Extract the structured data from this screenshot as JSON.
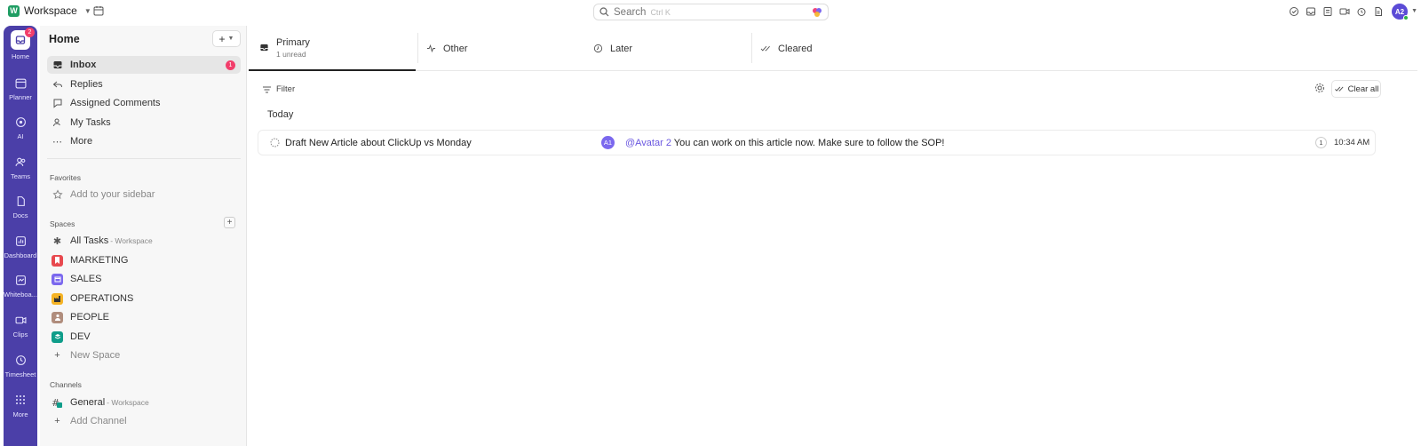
{
  "topbar": {
    "workspace_logo": "W",
    "workspace_name": "Workspace",
    "search_placeholder": "Search",
    "search_shortcut": "Ctrl K",
    "avatar": "A2"
  },
  "rail": {
    "home_badge": "2",
    "items": [
      {
        "label": "Home",
        "icon": "home-icon"
      },
      {
        "label": "Planner",
        "icon": "calendar-icon"
      },
      {
        "label": "AI",
        "icon": "ai-icon"
      },
      {
        "label": "Teams",
        "icon": "teams-icon"
      },
      {
        "label": "Docs",
        "icon": "docs-icon"
      },
      {
        "label": "Dashboard",
        "icon": "dashboard-icon"
      },
      {
        "label": "Whiteboa...",
        "icon": "whiteboard-icon"
      },
      {
        "label": "Clips",
        "icon": "clips-icon"
      },
      {
        "label": "Timesheet",
        "icon": "clock-icon"
      },
      {
        "label": "More",
        "icon": "grid-icon"
      }
    ]
  },
  "sidebar": {
    "title": "Home",
    "nav": [
      {
        "label": "Inbox",
        "badge": "1"
      },
      {
        "label": "Replies"
      },
      {
        "label": "Assigned Comments"
      },
      {
        "label": "My Tasks"
      },
      {
        "label": "More"
      }
    ],
    "favorites_label": "Favorites",
    "favorites_add": "Add to your sidebar",
    "spaces_label": "Spaces",
    "spaces": [
      {
        "label": "All Tasks",
        "sub": "- Workspace"
      },
      {
        "label": "MARKETING",
        "color": "#e8494f"
      },
      {
        "label": "SALES",
        "color": "#7b68ee"
      },
      {
        "label": "OPERATIONS",
        "color": "#f5b325"
      },
      {
        "label": "PEOPLE",
        "color": "#b08d7d"
      },
      {
        "label": "DEV",
        "color": "#0f9d8a"
      },
      {
        "label": "New Space"
      }
    ],
    "channels_label": "Channels",
    "channels": [
      {
        "label": "General",
        "sub": "- Workspace"
      },
      {
        "label": "Add Channel"
      }
    ]
  },
  "tabs": [
    {
      "label": "Primary",
      "count": "1 unread"
    },
    {
      "label": "Other"
    },
    {
      "label": "Later"
    },
    {
      "label": "Cleared"
    }
  ],
  "toolbar": {
    "filter": "Filter",
    "clear_all": "Clear all"
  },
  "group_label": "Today",
  "notification": {
    "task": "Draft New Article about ClickUp vs Monday",
    "avatar": "A1",
    "mention": "@Avatar 2",
    "message": " You can work on this article now. Make sure to follow the SOP!",
    "count": "1",
    "time": "10:34 AM"
  }
}
